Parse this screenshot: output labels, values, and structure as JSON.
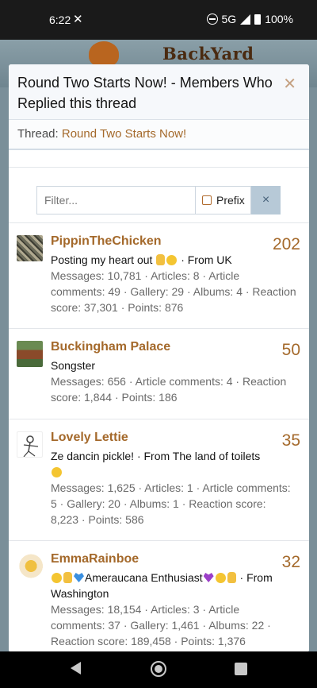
{
  "status_bar": {
    "time": "6:22",
    "network": "5G",
    "battery": "100%"
  },
  "background_site": {
    "logo_text": "BackYard Chickens"
  },
  "modal": {
    "title": "Round Two Starts Now! - Members Who Replied this thread",
    "thread_label": "Thread:",
    "thread_link": "Round Two Starts Now!"
  },
  "filter": {
    "placeholder": "Filter...",
    "prefix_label": "Prefix",
    "clear_icon": "×"
  },
  "members": [
    {
      "name": "PippinTheChicken",
      "count": "202",
      "title_text": "Posting my heart out",
      "title_suffix": "· From UK",
      "stats": "Messages: 10,781 · Articles: 8 · Article comments: 49 · Gallery: 29 · Albums: 4 · Reaction score: 37,301 · Points: 876"
    },
    {
      "name": "Buckingham Palace",
      "count": "50",
      "title_text": "Songster",
      "stats": "Messages: 656 · Article comments: 4 · Reaction score: 1,844 · Points: 186"
    },
    {
      "name": "Lovely Lettie",
      "count": "35",
      "title_text": "Ze dancin pickle! · From The land of toilets",
      "stats": "Messages: 1,625 · Articles: 1 · Article comments: 5 · Gallery: 20 · Albums: 1 · Reaction score: 8,223 · Points: 586"
    },
    {
      "name": "EmmaRainboe",
      "count": "32",
      "title_text": "Ameraucana Enthusiast",
      "title_suffix": "· From Washington",
      "stats": "Messages: 18,154 · Articles: 3 · Article comments: 37 · Gallery: 1,461 · Albums: 22 · Reaction score: 189,458 · Points: 1,376"
    }
  ],
  "colors": {
    "accent": "#a4692b",
    "clear_button": "#b7c9d7"
  }
}
